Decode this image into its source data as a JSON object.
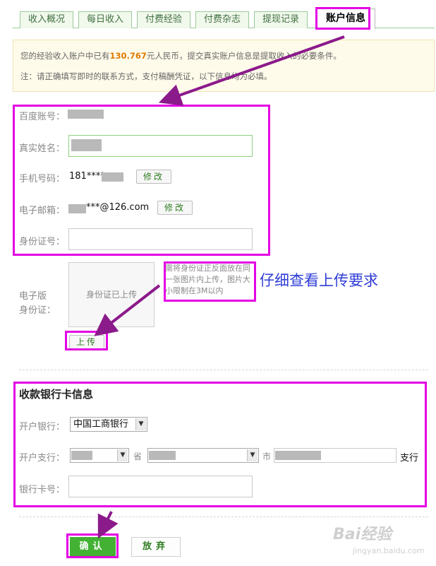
{
  "tabs": [
    {
      "label": "收入概况"
    },
    {
      "label": "每日收入"
    },
    {
      "label": "付费经验"
    },
    {
      "label": "付费杂志"
    },
    {
      "label": "提现记录"
    },
    {
      "label": "账户信息"
    }
  ],
  "notice": {
    "line1_prefix": "您的经验收入账户中已有",
    "amount": "130.767",
    "line1_suffix": "元人民币，提交真实账户信息是提取收入的必要条件。",
    "line2": "注：请正确填写即时的联系方式，支付稿酬凭证，以下信息均为必填。"
  },
  "account": {
    "baidu_label": "百度账号：",
    "realname_label": "真实姓名：",
    "phone_label": "手机号码：",
    "phone_value": "181****",
    "edit_label": "修改",
    "email_label": "电子邮箱：",
    "email_value": "***@126.com",
    "id_label": "身份证号："
  },
  "id_upload": {
    "label_line1": "电子版",
    "label_line2": "身份证：",
    "box_text": "身份证已上传",
    "tip": "需将身份证正反面放在同一张图片内上传，图片大小限制在3M以内",
    "upload_label": "上传"
  },
  "annotation": {
    "note": "仔细查看上传要求"
  },
  "bank": {
    "title": "收款银行卡信息",
    "bank_label": "开户银行：",
    "bank_value": "中国工商银行",
    "branch_label": "开户支行：",
    "province_suffix": "省",
    "city_suffix": "市",
    "branch_suffix": "支行",
    "card_label": "银行卡号："
  },
  "actions": {
    "confirm_label": "确认",
    "cancel_label": "放弃"
  },
  "watermark": {
    "brand": "Bai经验",
    "url": "jingyan.baidu.com"
  },
  "colors": {
    "highlight": "#e400e4",
    "arrow": "#8b1a8b",
    "confirm": "#43b133",
    "amount": "#e07b00",
    "note": "#2f3dd6"
  }
}
